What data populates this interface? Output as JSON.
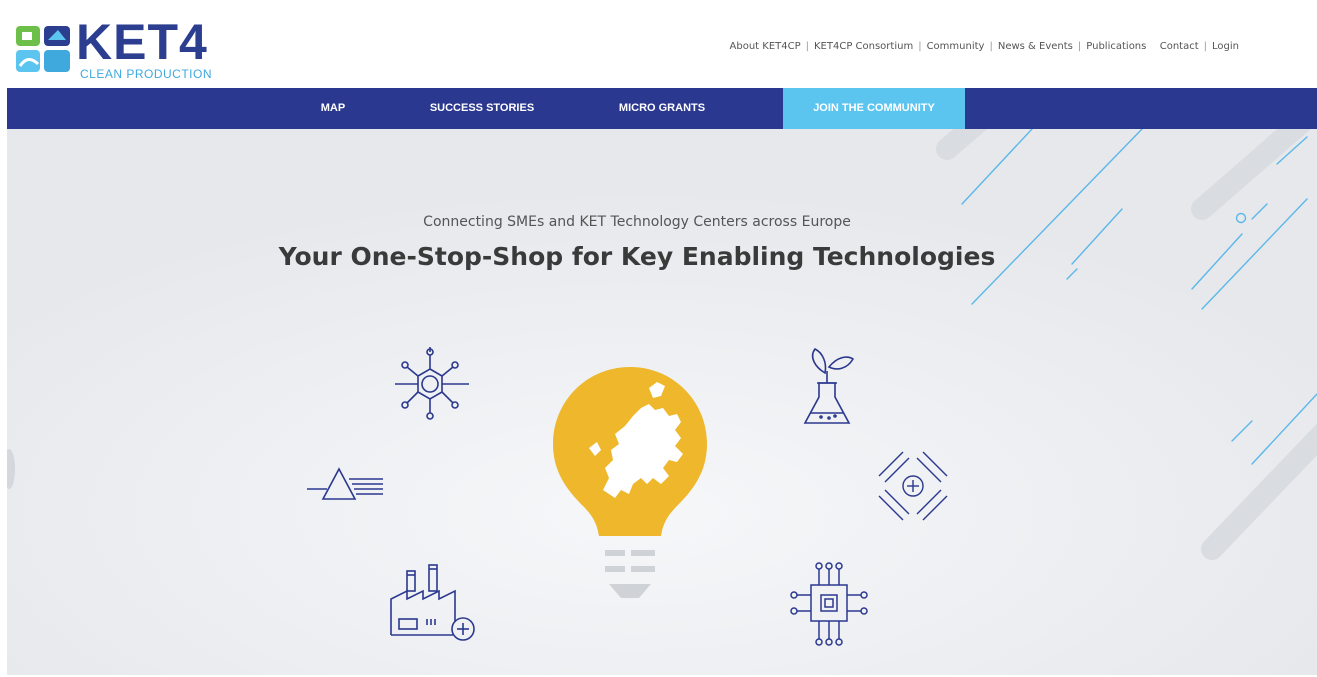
{
  "logo": {
    "main": "KET4",
    "sub": "CLEAN PRODUCTION"
  },
  "top_nav": [
    {
      "label": "About KET4CP"
    },
    {
      "label": "KET4CP Consortium"
    },
    {
      "label": "Community"
    },
    {
      "label": "News & Events"
    },
    {
      "label": "Publications"
    },
    {
      "label": "Contact"
    },
    {
      "label": "Login"
    }
  ],
  "main_nav": [
    {
      "label": "MAP"
    },
    {
      "label": "SUCCESS STORIES"
    },
    {
      "label": "MICRO GRANTS"
    },
    {
      "label": "JOIN THE COMMUNITY",
      "active": true
    }
  ],
  "hero": {
    "tagline": "Connecting SMEs and KET Technology Centers across Europe",
    "headline": "Your One-Stop-Shop for Key Enabling Technologies"
  },
  "icons": [
    "nanotechnology-icon",
    "photonics-icon",
    "advanced-manufacturing-icon",
    "biotechnology-icon",
    "advanced-materials-icon",
    "micro-nanoelectronics-icon",
    "lightbulb-europe-icon"
  ],
  "colors": {
    "brand_blue": "#2b388f",
    "accent_cyan": "#5bc5f0",
    "bulb_yellow": "#eeb72c",
    "hero_bg": "#eceef1"
  }
}
